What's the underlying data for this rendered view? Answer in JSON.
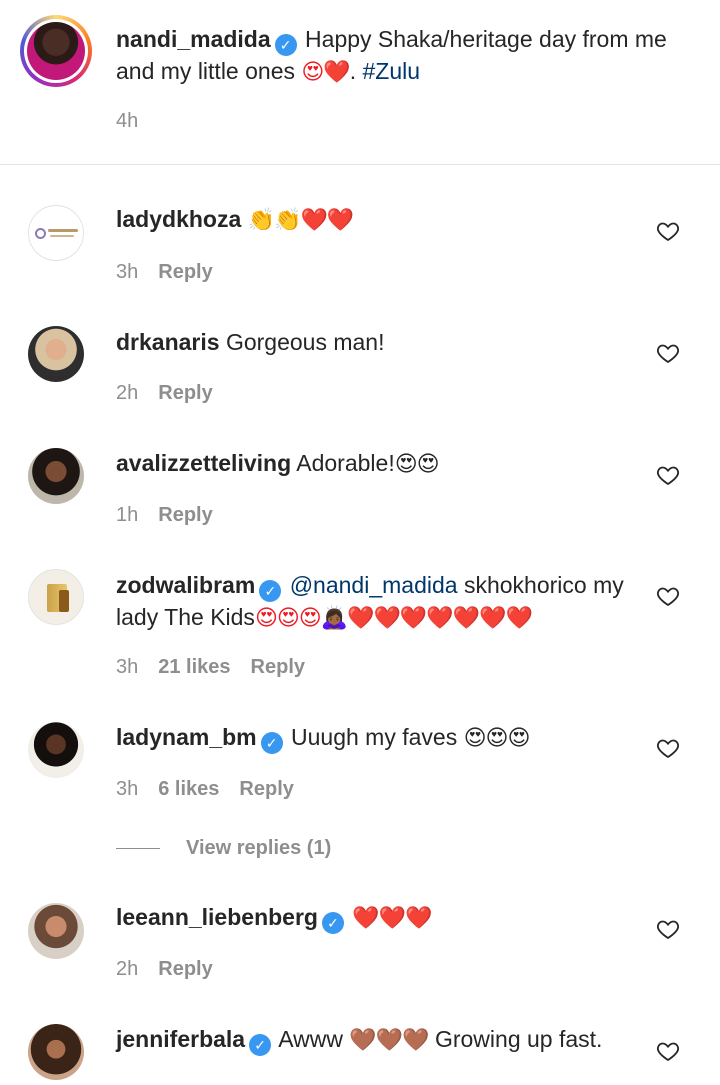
{
  "post": {
    "username": "nandi_madida",
    "verified": true,
    "caption_text": "Happy Shaka/heritage day from me and my little ones",
    "caption_emoji": "😍❤️",
    "caption_sep": ".",
    "hashtag": "#Zulu",
    "time": "4h"
  },
  "comments": [
    {
      "username": "ladydkhoza",
      "verified": false,
      "text": "",
      "emoji": "👏👏❤️❤️",
      "time": "3h",
      "likes": "",
      "reply_label": "Reply"
    },
    {
      "username": "drkanaris",
      "verified": false,
      "text": "Gorgeous man!",
      "emoji": "",
      "time": "2h",
      "likes": "",
      "reply_label": "Reply"
    },
    {
      "username": "avalizzetteliving",
      "verified": false,
      "text": "Adorable!",
      "emoji": "😍😍",
      "time": "1h",
      "likes": "",
      "reply_label": "Reply"
    },
    {
      "username": "zodwalibram",
      "verified": true,
      "mention": "@nandi_madida",
      "text": "skhokhorico my lady The Kids",
      "emoji": "😍😍😍🙇🏾‍♀️❤️❤️❤️❤️❤️❤️❤️",
      "time": "3h",
      "likes": "21 likes",
      "reply_label": "Reply"
    },
    {
      "username": "ladynam_bm",
      "verified": true,
      "text": "Uuugh my faves",
      "emoji": "😍😍😍",
      "time": "3h",
      "likes": "6 likes",
      "reply_label": "Reply",
      "view_replies": "View replies (1)"
    },
    {
      "username": "leeann_liebenberg",
      "verified": true,
      "text": "",
      "emoji": "❤️❤️❤️",
      "time": "2h",
      "likes": "",
      "reply_label": "Reply"
    },
    {
      "username": "jenniferbala",
      "verified": true,
      "text_before": "Awww",
      "emoji": "🤎🤎🤎",
      "text": "Growing up fast.",
      "time": "",
      "likes": "",
      "reply_label": ""
    }
  ],
  "icons": {
    "verified": "verified-badge-icon",
    "like": "heart-outline-icon"
  },
  "colors": {
    "verified": "#3897f0",
    "link": "#00376b",
    "muted": "#8e8e8e",
    "heart": "#ed1c24"
  }
}
